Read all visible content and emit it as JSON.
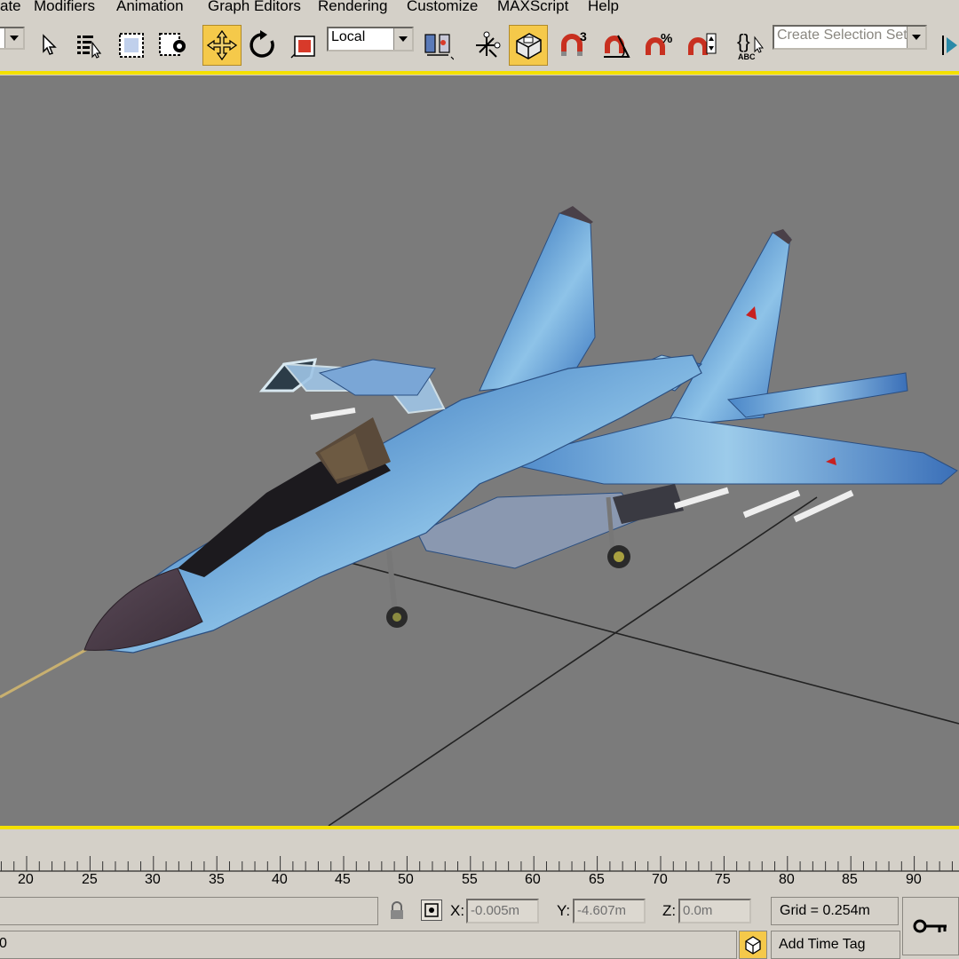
{
  "menubar": {
    "items": [
      "ate",
      "Modifiers",
      "Animation",
      "Graph Editors",
      "Rendering",
      "Customize",
      "MAXScript",
      "Help"
    ]
  },
  "toolbar": {
    "coord_system": "Local",
    "selection_set_placeholder": "Create Selection Set",
    "snap_angle_label": "3",
    "percent_snap_label": "%",
    "named_sets_label": "ABC",
    "accent_color": "#f5c94a"
  },
  "viewport": {
    "background": "#7b7b7b",
    "border_color": "#f4e100",
    "object": "fighter-jet-model"
  },
  "timeline": {
    "ticks": [
      "20",
      "25",
      "30",
      "35",
      "40",
      "45",
      "50",
      "55",
      "60",
      "65",
      "70",
      "75",
      "80",
      "85",
      "90"
    ]
  },
  "status": {
    "x_label": "X:",
    "x_value": "-0.005m",
    "y_label": "Y:",
    "y_value": "-4.607m",
    "z_label": "Z:",
    "z_value": "0.0m",
    "grid_text": "Grid = 0.254m",
    "add_time_tag": "Add Time Tag",
    "left_value": "0"
  }
}
